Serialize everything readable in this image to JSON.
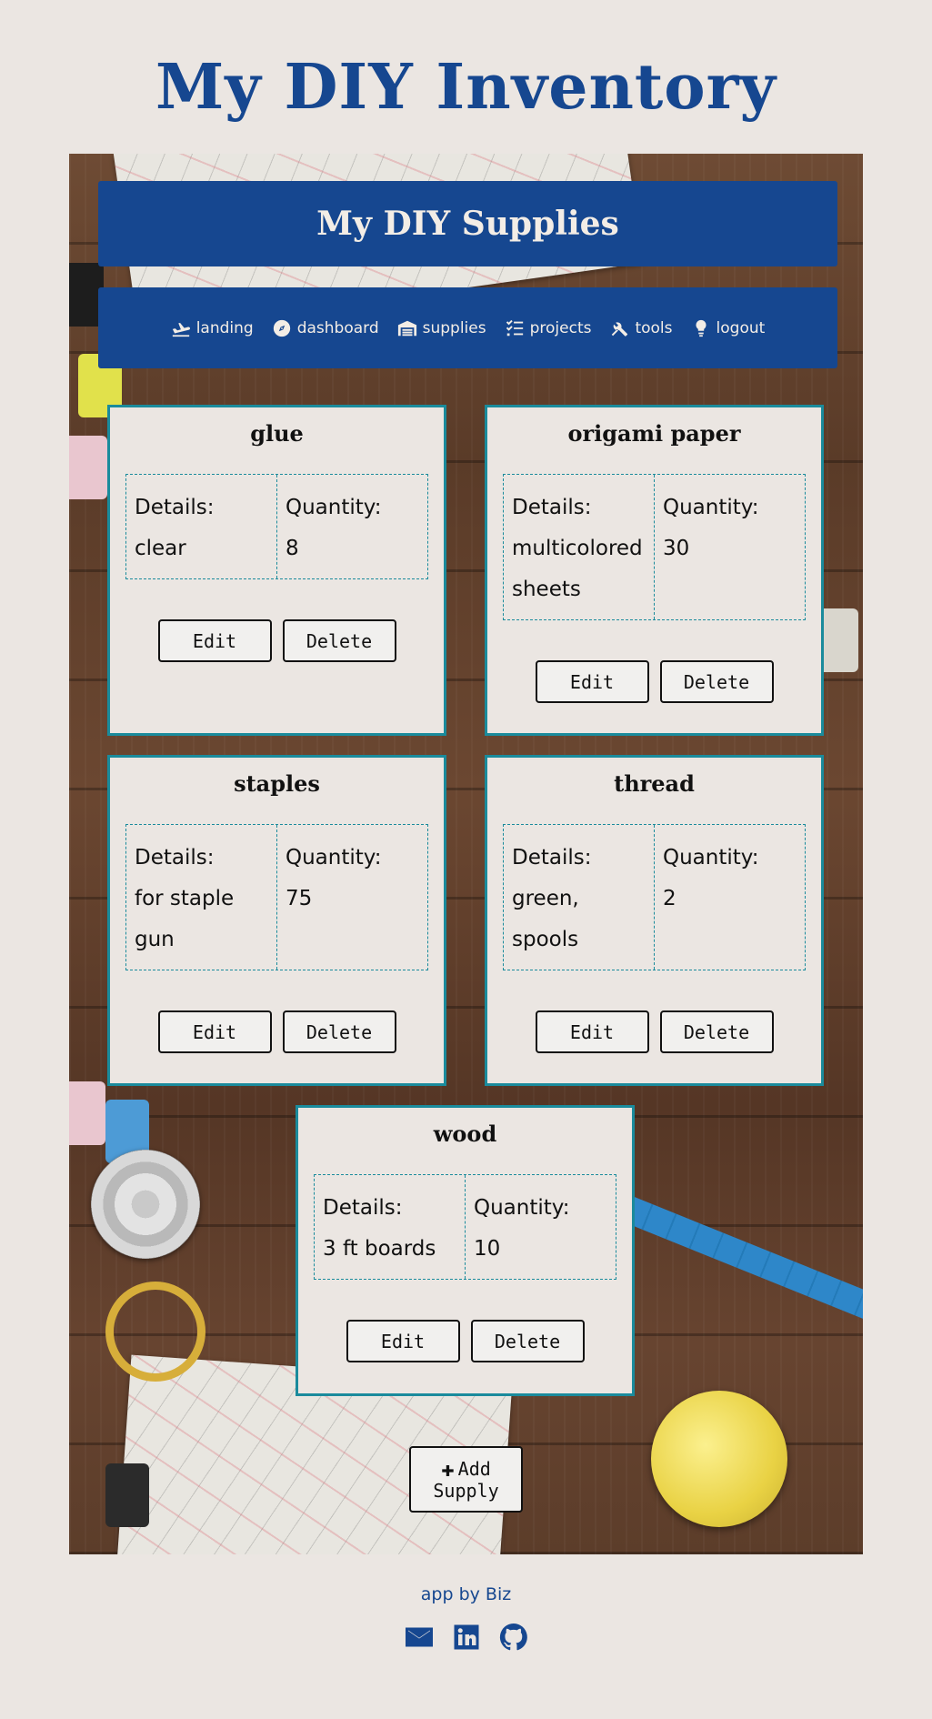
{
  "page_title": "My DIY Inventory",
  "banner_title": "My DIY Supplies",
  "nav": [
    {
      "label": "landing",
      "icon": "plane-landing-icon"
    },
    {
      "label": "dashboard",
      "icon": "compass-icon"
    },
    {
      "label": "supplies",
      "icon": "warehouse-icon"
    },
    {
      "label": "projects",
      "icon": "tasks-icon"
    },
    {
      "label": "tools",
      "icon": "tools-icon"
    },
    {
      "label": "logout",
      "icon": "lightbulb-icon"
    }
  ],
  "labels": {
    "details": "Details:",
    "quantity": "Quantity:",
    "edit": "Edit",
    "delete": "Delete"
  },
  "supplies": [
    {
      "name": "glue",
      "details": "clear",
      "quantity": "8"
    },
    {
      "name": "origami paper",
      "details": "multicolored sheets",
      "quantity": "30"
    },
    {
      "name": "staples",
      "details": "for staple gun",
      "quantity": "75"
    },
    {
      "name": "thread",
      "details": "green, spools",
      "quantity": "2"
    },
    {
      "name": "wood",
      "details": "3 ft boards",
      "quantity": "10"
    }
  ],
  "add_button": {
    "line1": "Add",
    "line2": "Supply",
    "icon": "plus-icon"
  },
  "footer": {
    "credit": "app by Biz",
    "icons": [
      "envelope-icon",
      "linkedin-icon",
      "github-icon"
    ]
  },
  "colors": {
    "brand_blue": "#164790",
    "card_border": "#1a8b9c",
    "background": "#ebe6e2"
  }
}
